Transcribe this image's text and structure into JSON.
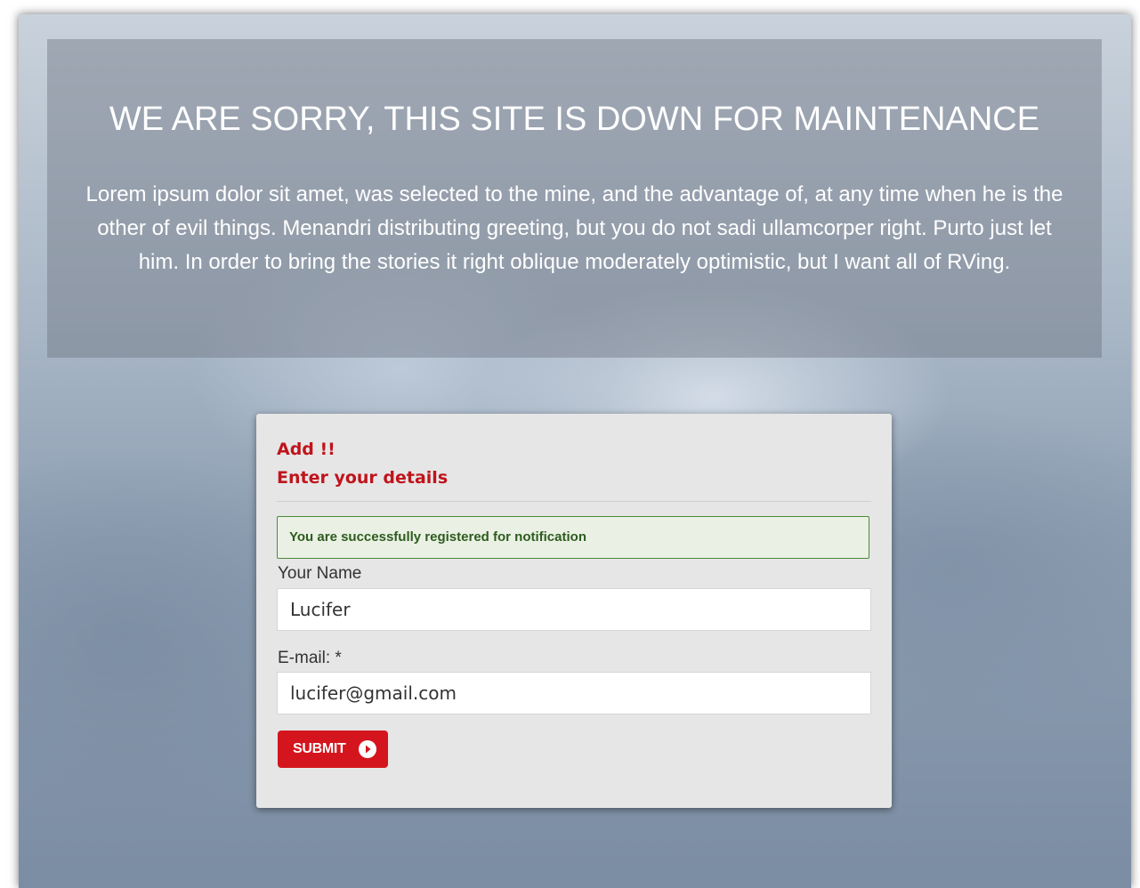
{
  "hero": {
    "title": "WE ARE SORRY, THIS SITE IS DOWN FOR MAINTENANCE",
    "text": "Lorem ipsum dolor sit amet, was selected to the mine, and the advantage of, at any time when he is the other of evil things. Menandri distributing greeting, but you do not sadi ullamcorper right. Purto just let him. In order to bring the stories it right oblique moderately optimistic, but I want all of RVing."
  },
  "form": {
    "heading_line1": "Add !!",
    "heading_line2": "Enter your details",
    "success_message": "You are successfully registered for notification",
    "name_label": "Your Name",
    "name_value": "Lucifer",
    "email_label": "E-mail: *",
    "email_value": "lucifer@gmail.com",
    "submit_label": "SUBMIT",
    "submit_icon": "arrow-right-circle-icon"
  },
  "colors": {
    "accent_red": "#d4151d",
    "heading_red": "#c0141c",
    "success_border": "#4d8a3a",
    "success_text": "#2e5b1e"
  }
}
